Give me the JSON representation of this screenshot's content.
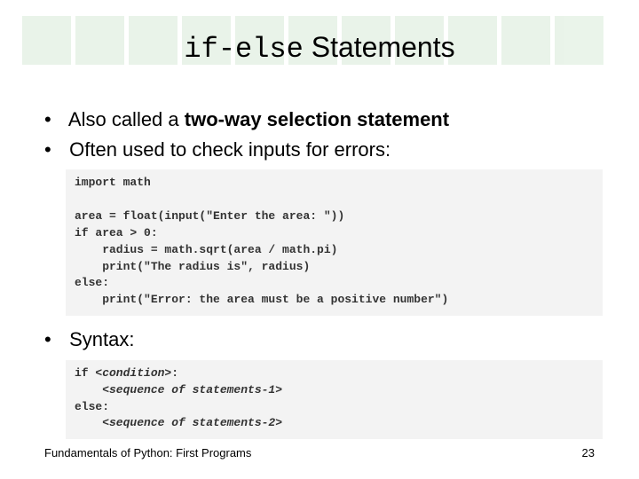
{
  "title": {
    "mono": "if-else",
    "rest": " Statements"
  },
  "bullets": {
    "b1_pre": "Also called a ",
    "b1_bold": "two-way selection statement",
    "b2": "Often used to check inputs for errors:",
    "b3": "Syntax:"
  },
  "code1": "import math\n\narea = float(input(\"Enter the area: \"))\nif area > 0:\n    radius = math.sqrt(area / math.pi)\n    print(\"The radius is\", radius)\nelse:\n    print(\"Error: the area must be a positive number\")",
  "code2_lines": {
    "l1a": "if ",
    "l1b": "<condition>",
    "l1c": ":",
    "l2": "    <sequence of statements-1>",
    "l3": "else:",
    "l4": "    <sequence of statements-2>"
  },
  "footer": {
    "left": "Fundamentals of Python: First Programs",
    "right": "23"
  }
}
